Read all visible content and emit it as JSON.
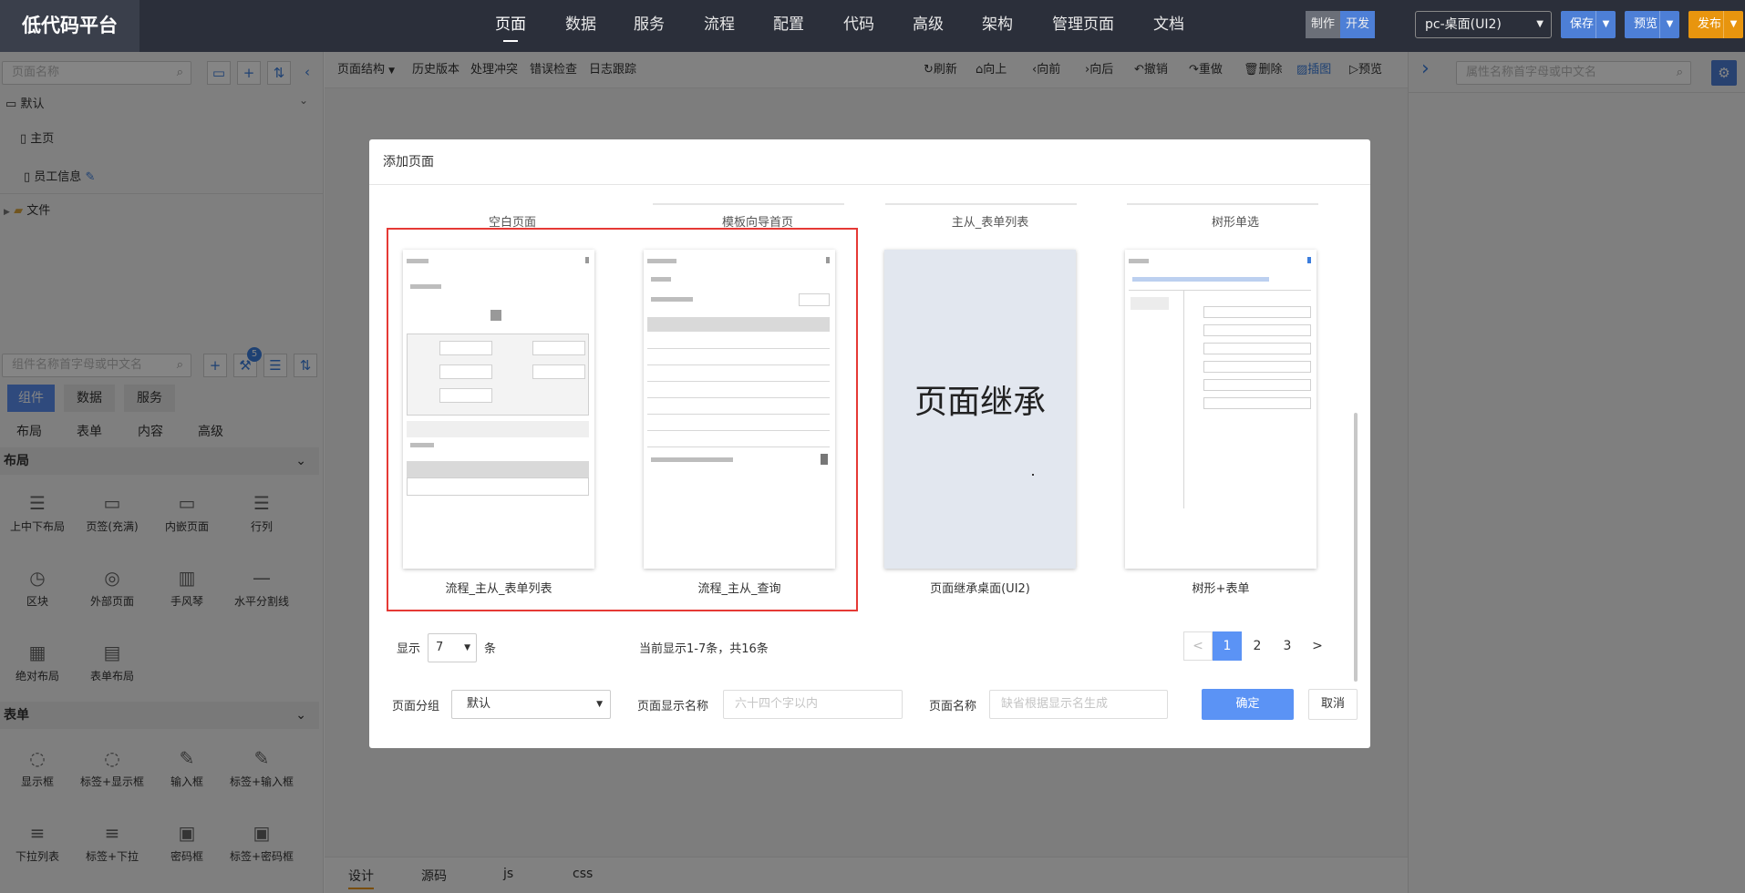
{
  "app": {
    "logo": "低代码平台"
  },
  "nav": [
    "页面",
    "数据",
    "服务",
    "流程",
    "配置",
    "代码",
    "高级",
    "架构",
    "管理页面",
    "文档"
  ],
  "mode": {
    "make": "制作",
    "dev": "开发"
  },
  "device": "pc-桌面(UI2)",
  "top_buttons": {
    "save": "保存",
    "preview": "预览",
    "publish": "发布"
  },
  "left": {
    "page_search_placeholder": "页面名称",
    "tree": {
      "group": "默认",
      "home": "主页",
      "staff": "员工信息",
      "folder": "文件"
    },
    "comp_search_placeholder": "组件名称首字母或中文名",
    "badge": "5",
    "tabs": [
      "组件",
      "数据",
      "服务"
    ],
    "subtabs": [
      "布局",
      "表单",
      "内容",
      "高级"
    ],
    "section_layout": "布局",
    "layout_items": [
      "上中下布局",
      "页签(充满)",
      "内嵌页面",
      "行列",
      "区块",
      "外部页面",
      "手风琴",
      "水平分割线",
      "绝对布局",
      "表单布局"
    ],
    "section_form": "表单",
    "form_items": [
      "显示框",
      "标签+显示框",
      "输入框",
      "标签+输入框",
      "下拉列表",
      "标签+下拉",
      "密码框",
      "标签+密码框"
    ]
  },
  "toolbar": {
    "left": [
      "页面结构",
      "历史版本",
      "处理冲突",
      "错误检查",
      "日志跟踪"
    ],
    "right": [
      "刷新",
      "向上",
      "向前",
      "向后",
      "撤销",
      "重做",
      "删除",
      "插图",
      "预览"
    ]
  },
  "bottom_tabs": [
    "设计",
    "源码",
    "js",
    "css"
  ],
  "right_panel": {
    "search_placeholder": "属性名称首字母或中文名"
  },
  "modal": {
    "title": "添加页面",
    "top_row": [
      "空白页面",
      "模板向导首页",
      "主从_表单列表",
      "树形单选"
    ],
    "cards": [
      "流程_主从_表单列表",
      "流程_主从_查询",
      "页面继承桌面(UI2)",
      "树形+表单"
    ],
    "inherit_text": "页面继承",
    "show_label": "显示",
    "show_value": "7",
    "show_unit": "条",
    "summary": "当前显示1-7条，共16条",
    "pages": [
      "<",
      "1",
      "2",
      "3",
      ">"
    ],
    "active_page": "1",
    "group_label": "页面分组",
    "group_value": "默认",
    "display_name_label": "页面显示名称",
    "display_name_placeholder": "六十四个字以内",
    "page_name_label": "页面名称",
    "page_name_placeholder": "缺省根据显示名生成",
    "ok": "确定",
    "cancel": "取消"
  }
}
